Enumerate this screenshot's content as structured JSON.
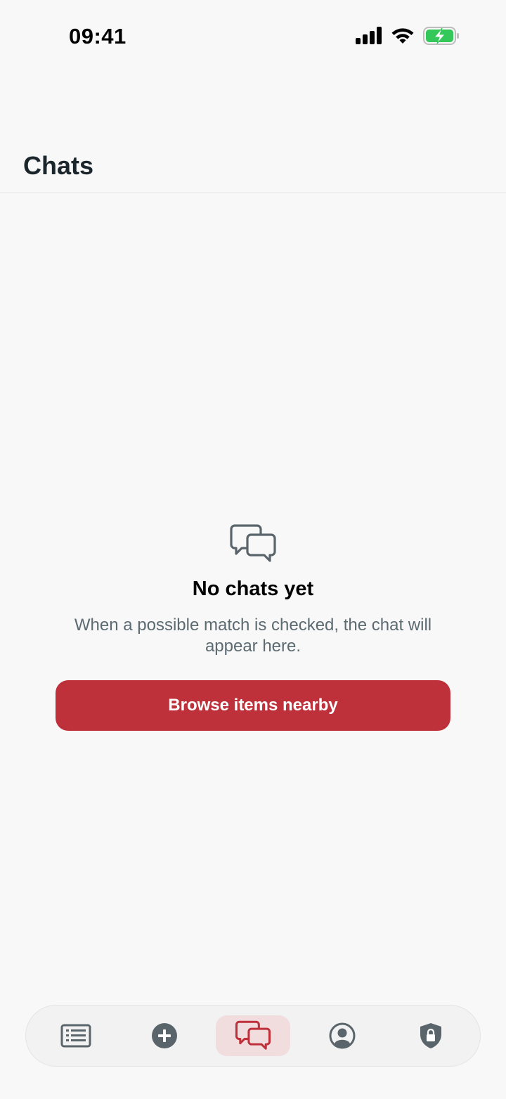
{
  "status_bar": {
    "time": "09:41",
    "icons": [
      "cellular-signal-icon",
      "wifi-icon",
      "battery-charging-icon"
    ]
  },
  "header": {
    "title": "Chats"
  },
  "empty_state": {
    "icon": "chat-bubbles-icon",
    "title": "No chats yet",
    "description": "When a possible match is checked, the chat will appear here.",
    "button_label": "Browse items nearby"
  },
  "tab_bar": {
    "tabs": [
      {
        "icon": "list-icon",
        "active": false
      },
      {
        "icon": "add-circle-icon",
        "active": false
      },
      {
        "icon": "chat-bubbles-icon",
        "active": true
      },
      {
        "icon": "profile-icon",
        "active": false
      },
      {
        "icon": "shield-lock-icon",
        "active": false
      }
    ]
  },
  "colors": {
    "accent": "#bf313a",
    "accent_light": "#f1dcde",
    "icon_gray": "#5a656b",
    "title_dark": "#1b262c",
    "background": "#f8f8f8",
    "battery_green": "#34c759"
  }
}
